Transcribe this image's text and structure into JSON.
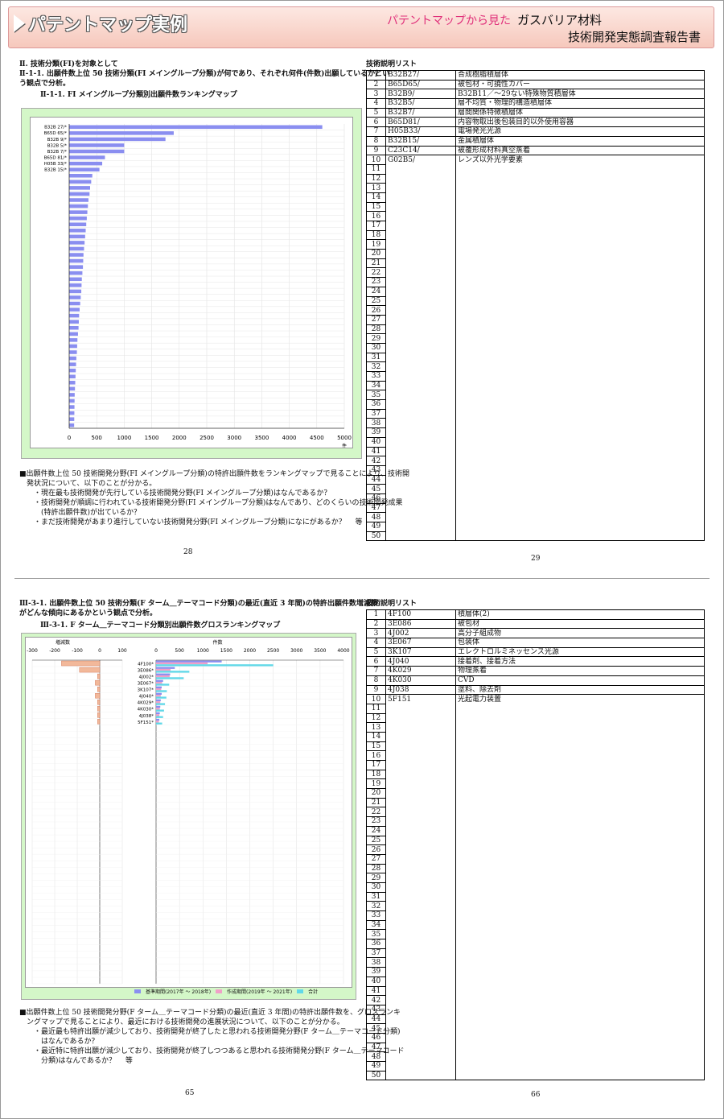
{
  "header": {
    "title": "パテントマップ実例",
    "subtitle1": "パテントマップから見た",
    "subtitle2": "ガスバリア材料",
    "subtitle3": "技術開発実態調査報告書"
  },
  "page1": {
    "section_title": "Ⅱ. 技術分類(FI)を対象として",
    "desc_line1": "Ⅱ-1-1. 出願件数上位 50 技術分類(FI メイングループ分類)が何であり、それぞれ何件(件数)出願しているかとい",
    "desc_line2": "う観点で分析。",
    "chart_title": "Ⅱ-1-1. FI メイングループ分類別出願件数ランキングマップ",
    "unit_label": "件",
    "notes": [
      "■出願件数上位 50 技術開発分野(FI メイングループ分類)の特許出願件数をランキングマップで見ることにより、技術開",
      "　発状況について、以下のことが分かる。",
      "・現在最も技術開発が先行している技術開発分野(FI メイングループ分類)はなんであるか？",
      "・技術開発が順調に行われている技術開発分野(FI メイングループ分類)はなんであり、どのくらいの技術開発成果",
      "　(特許出願件数)が出ているか？",
      "・まだ技術開発があまり進行していない技術開発分野(FI メイングループ分類)になにがあるか？　 等"
    ],
    "page_left": "28",
    "page_right": "29",
    "list_title": "技術説明リスト",
    "list": [
      {
        "no": "1",
        "code": "B32B27/",
        "desc": "合成樹脂積層体"
      },
      {
        "no": "2",
        "code": "B65D65/",
        "desc": "被包材・可撓性カバー"
      },
      {
        "no": "3",
        "code": "B32B9/",
        "desc": "B32B11／～29ない特殊物質積層体"
      },
      {
        "no": "4",
        "code": "B32B5/",
        "desc": "層不均質・物理的構造積層体"
      },
      {
        "no": "5",
        "code": "B32B7/",
        "desc": "層間関係特徴積層体"
      },
      {
        "no": "6",
        "code": "B65D81/",
        "desc": "内容物取出後包装目的以外使用容器"
      },
      {
        "no": "7",
        "code": "H05B33/",
        "desc": "電場発光光源"
      },
      {
        "no": "8",
        "code": "B32B15/",
        "desc": "金属積層体"
      },
      {
        "no": "9",
        "code": "C23C14/",
        "desc": "被覆形成材料真空蒸着"
      },
      {
        "no": "10",
        "code": "G02B5/",
        "desc": "レンズ以外光学要素"
      }
    ]
  },
  "page2": {
    "desc_line1": "Ⅲ-3-1. 出願件数上位 50 技術分類(F ターム＿テーマコード分類)の最近(直近 3 年間)の特許出願件数増減数",
    "desc_line2": "がどんな傾向にあるかという観点で分析。",
    "chart_title": "Ⅲ-3-1. F ターム＿テーマコード分類別出願件数グロスランキングマップ",
    "left_axis_title": "増減数",
    "right_axis_title": "件数",
    "legend": [
      "基準期間(2017年 ～ 2018年)",
      "作成期間(2019年 ～ 2021年)",
      "合計"
    ],
    "notes": [
      "■出願件数上位 50 技術開発分野(F ターム＿テーマコード分類)の最近(直近 3 年間)の特許出願件数を、グロスランキ",
      "　ングマップで見ることにより、最近における技術開発の進展状況について、以下のことが分かる。",
      "・最近最も特許出願が減少しており、技術開発が終了したと思われる技術開発分野(F ターム＿テーマコード分類)",
      "　はなんであるか？",
      "・最近特に特許出願が減少しており、技術開発が終了しつつあると思われる技術開発分野(F ターム＿テーマコード",
      "　分類)はなんであるか？　 等"
    ],
    "page_left": "65",
    "page_right": "66",
    "list_title": "技術説明リスト",
    "list": [
      {
        "no": "1",
        "code": "4F100",
        "desc": "積層体(2)"
      },
      {
        "no": "2",
        "code": "3E086",
        "desc": "被包材"
      },
      {
        "no": "3",
        "code": "4J002",
        "desc": "高分子組成物"
      },
      {
        "no": "4",
        "code": "3E067",
        "desc": "包装体"
      },
      {
        "no": "5",
        "code": "3K107",
        "desc": "エレクトロルミネッセンス光源"
      },
      {
        "no": "6",
        "code": "4J040",
        "desc": "接着剤、接着方法"
      },
      {
        "no": "7",
        "code": "4K029",
        "desc": "物理蒸着"
      },
      {
        "no": "8",
        "code": "4K030",
        "desc": "CVD"
      },
      {
        "no": "9",
        "code": "4J038",
        "desc": "塗料、除去剤"
      },
      {
        "no": "10",
        "code": "5F151",
        "desc": "光起電力装置"
      }
    ]
  },
  "colors": {
    "bar_blue": "#8a8ef0",
    "bar_pink": "#f0a0c8",
    "bar_cyan": "#60d8e8",
    "bar_orange": "#f2b89a",
    "chart_bg": "#d4f7c8"
  },
  "chart_data": [
    {
      "type": "bar",
      "orientation": "horizontal",
      "categories": [
        "B32B 27/*",
        "B65D 65/*",
        "B32B 9/*",
        "B32B 5/*",
        "B32B 7/*",
        "B65D 81/*",
        "H05B 33/*",
        "B32B 15/*"
      ],
      "values": [
        4600,
        1900,
        1750,
        1000,
        1000,
        650,
        600,
        550,
        420,
        400,
        380,
        370,
        350,
        340,
        330,
        320,
        310,
        300,
        290,
        280,
        270,
        260,
        255,
        250,
        240,
        230,
        225,
        220,
        210,
        200,
        190,
        180,
        175,
        170,
        160,
        150,
        145,
        140,
        130,
        125,
        120,
        115,
        110,
        105,
        100,
        98,
        96,
        94,
        92,
        90
      ],
      "xlim": [
        0,
        5000
      ],
      "xticks": [
        0,
        500,
        1000,
        1500,
        2000,
        2500,
        3000,
        3500,
        4000,
        4500,
        5000
      ]
    },
    {
      "type": "bar",
      "orientation": "horizontal",
      "categories": [
        "4F100*",
        "3E086*",
        "4J002*",
        "3E067*",
        "3K107*",
        "4J040*",
        "4K029*",
        "4K030*",
        "4J038*",
        "5F151*"
      ],
      "series": [
        {
          "name": "基準期間(2017年 ～ 2018年)",
          "values": [
            1400,
            400,
            300,
            150,
            120,
            120,
            100,
            90,
            80,
            70
          ]
        },
        {
          "name": "作成期間(2019年 ～ 2021年)",
          "values": [
            1100,
            310,
            290,
            130,
            110,
            100,
            90,
            80,
            70,
            60
          ]
        },
        {
          "name": "合計",
          "values": [
            2500,
            710,
            590,
            280,
            230,
            220,
            190,
            170,
            150,
            130
          ]
        }
      ],
      "change": [
        -170,
        -90,
        -10,
        -20,
        -10,
        -20,
        -10,
        -10,
        -10,
        -10
      ],
      "left_xlim": [
        -300,
        100
      ],
      "left_xticks": [
        -300,
        -200,
        -100,
        0,
        100
      ],
      "right_xlim": [
        0,
        4000
      ],
      "right_xticks": [
        0,
        500,
        1000,
        1500,
        2000,
        2500,
        3000,
        3500,
        4000
      ]
    }
  ]
}
